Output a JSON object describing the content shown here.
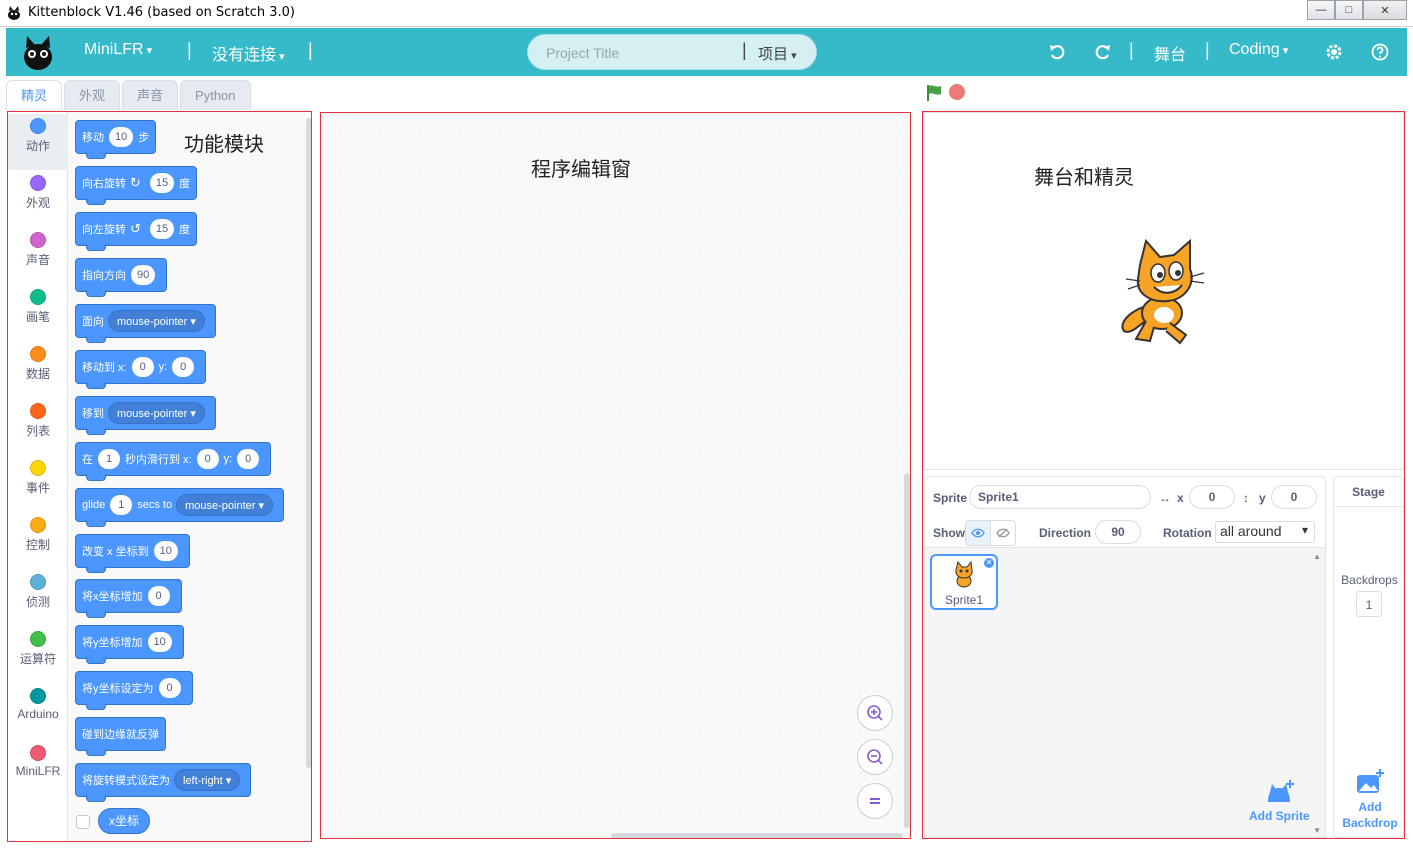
{
  "window": {
    "title": "Kittenblock V1.46 (based on Scratch 3.0)",
    "minimize": "—",
    "maximize": "□",
    "close": "✕"
  },
  "menubar": {
    "device": "MiniLFR",
    "connection": "没有连接",
    "separator": "|",
    "project_title_placeholder": "Project Title",
    "project_menu": "项目",
    "stage": "舞台",
    "mode": "Coding",
    "bg_color": "#36b9c8",
    "icons": [
      "undo-icon",
      "redo-icon",
      "gear-icon",
      "help-icon"
    ]
  },
  "tabs": [
    "精灵",
    "外观",
    "声音",
    "Python"
  ],
  "categories": [
    {
      "label": "动作",
      "color": "#4c97ff"
    },
    {
      "label": "外观",
      "color": "#9966ff"
    },
    {
      "label": "声音",
      "color": "#cf63cf"
    },
    {
      "label": "画笔",
      "color": "#0fbd8c"
    },
    {
      "label": "数据",
      "color": "#ff8c1a"
    },
    {
      "label": "列表",
      "color": "#ff661a"
    },
    {
      "label": "事件",
      "color": "#ffd500"
    },
    {
      "label": "控制",
      "color": "#ffab19"
    },
    {
      "label": "侦测",
      "color": "#5cb1d6"
    },
    {
      "label": "运算符",
      "color": "#40bf4a"
    },
    {
      "label": "Arduino",
      "color": "#00979c"
    },
    {
      "label": "MiniLFR",
      "color": "#ee5a6f"
    }
  ],
  "palette": {
    "label": "功能模块",
    "blocks": {
      "move": {
        "a": "移动",
        "v": "10",
        "b": "步"
      },
      "turn_right": {
        "a": "向右旋转",
        "v": "15",
        "b": "度"
      },
      "turn_left": {
        "a": "向左旋转",
        "v": "15",
        "b": "度"
      },
      "point_dir": {
        "a": "指向方向",
        "v": "90"
      },
      "point_towards": {
        "a": "面向",
        "m": "mouse-pointer"
      },
      "goto_xy": {
        "a": "移动到 x:",
        "x": "0",
        "b": "y:",
        "y": "0"
      },
      "goto": {
        "a": "移到",
        "m": "mouse-pointer"
      },
      "glide_xy": {
        "a": "在",
        "t": "1",
        "b": "秒内滑行到 x:",
        "x": "0",
        "c": "y:",
        "y": "0"
      },
      "glide_to": {
        "a": "glide",
        "t": "1",
        "b": "secs to",
        "m": "mouse-pointer"
      },
      "change_x": {
        "a": "改变 x 坐标到",
        "v": "10"
      },
      "inc_x": {
        "a": "将x坐标增加",
        "v": "0"
      },
      "inc_y": {
        "a": "将y坐标增加",
        "v": "10"
      },
      "set_y": {
        "a": "将y坐标设定为",
        "v": "0"
      },
      "bounce": {
        "a": "碰到边缘就反弹"
      },
      "rot_style": {
        "a": "将旋转模式设定为",
        "m": "left-right"
      },
      "x_reporter": "x坐标"
    }
  },
  "editor": {
    "label": "程序编辑窗"
  },
  "stage": {
    "label": "舞台和精灵"
  },
  "sprite_info": {
    "sprite_label": "Sprite",
    "sprite_name": "Sprite1",
    "x_label": "x",
    "x": "0",
    "y_label": "y",
    "y": "0",
    "show_label": "Show",
    "direction_label": "Direction",
    "direction": "90",
    "rotation_label": "Rotation",
    "rotation": "all around"
  },
  "sprites": [
    {
      "name": "Sprite1"
    }
  ],
  "add_sprite": "Add Sprite",
  "stage_target": {
    "title": "Stage",
    "backdrops_label": "Backdrops",
    "backdrops_count": "1",
    "add_backdrop": "Add Backdrop"
  },
  "annotation_color": "#e0303c"
}
